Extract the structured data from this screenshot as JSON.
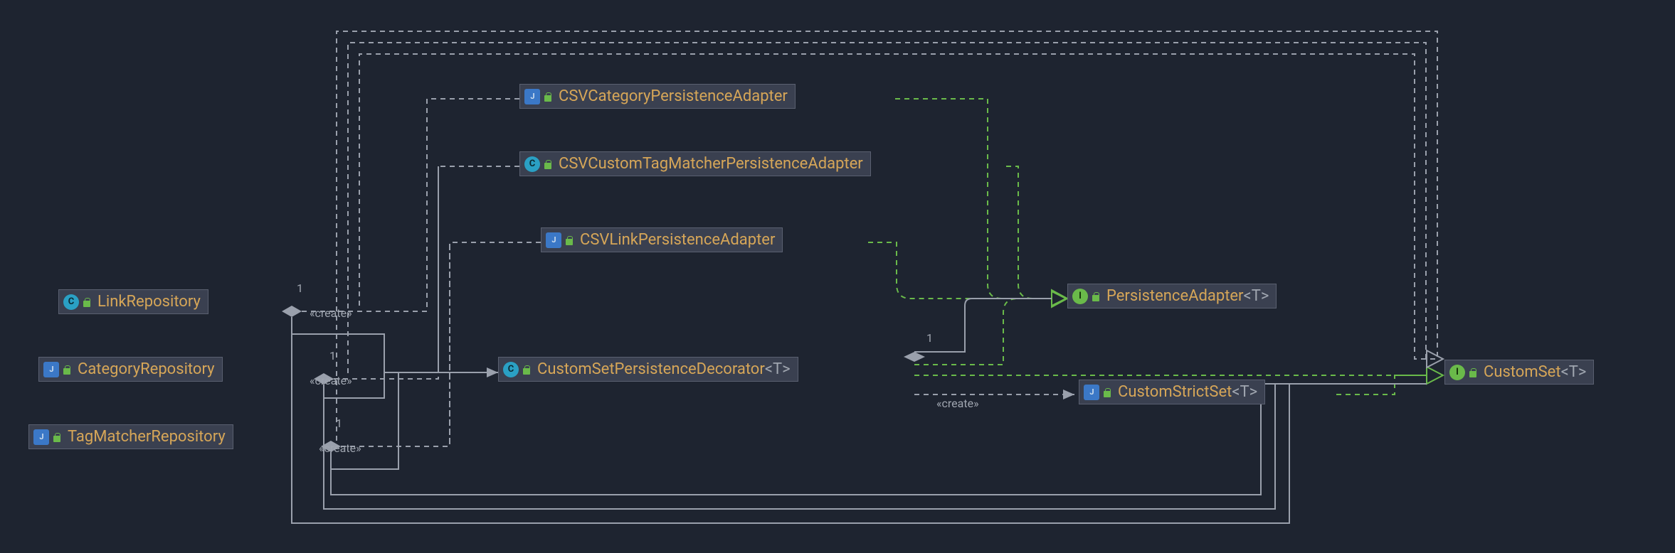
{
  "nodes": {
    "csvCategory": {
      "label": "CSVCategoryPersistenceAdapter",
      "icon": "J"
    },
    "csvCustomTag": {
      "label": "CSVCustomTagMatcherPersistenceAdapter",
      "icon": "C"
    },
    "csvLink": {
      "label": "CSVLinkPersistenceAdapter",
      "icon": "J"
    },
    "linkRepo": {
      "label": "LinkRepository",
      "icon": "C"
    },
    "categoryRepo": {
      "label": "CategoryRepository",
      "icon": "J"
    },
    "tagMatcherRepo": {
      "label": "TagMatcherRepository",
      "icon": "J"
    },
    "customSetDecorator": {
      "label": "CustomSetPersistenceDecorator",
      "icon": "C",
      "tparam": "<T>"
    },
    "persistenceAdapter": {
      "label": "PersistenceAdapter",
      "icon": "I",
      "tparam": "<T>"
    },
    "customStrictSet": {
      "label": "CustomStrictSet",
      "icon": "J",
      "tparam": "<T>"
    },
    "customSet": {
      "label": "CustomSet",
      "icon": "I",
      "tparam": "<T>"
    }
  },
  "labels": {
    "one": "1",
    "create": "«create»"
  }
}
